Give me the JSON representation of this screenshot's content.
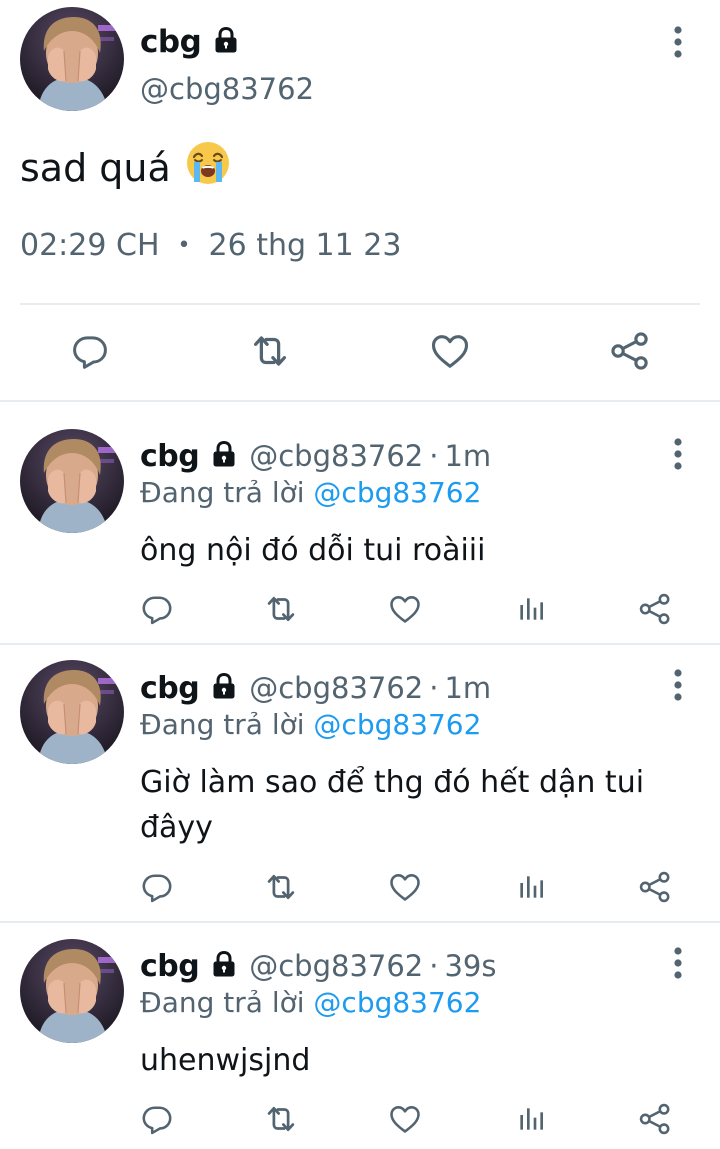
{
  "main_tweet": {
    "name": "cbg",
    "handle": "@cbg83762",
    "text": "sad quá",
    "emoji": "loudly-crying-face-emoji",
    "time": "02:29 CH",
    "separator": "•",
    "date": "26 thg 11 23"
  },
  "replies": [
    {
      "name": "cbg",
      "handle": "@cbg83762",
      "sep": "·",
      "time": "1m",
      "replying_prefix": "Đang trả lời",
      "replying_to": "@cbg83762",
      "text": "ông nội đó dỗi tui roàiii"
    },
    {
      "name": "cbg",
      "handle": "@cbg83762",
      "sep": "·",
      "time": "1m",
      "replying_prefix": "Đang trả lời",
      "replying_to": "@cbg83762",
      "text": "Giờ làm sao để thg đó hết dận tui đâyy"
    },
    {
      "name": "cbg",
      "handle": "@cbg83762",
      "sep": "·",
      "time": "39s",
      "replying_prefix": "Đang trả lời",
      "replying_to": "@cbg83762",
      "text": "uhenwjsjnd"
    }
  ],
  "icons": {
    "lock": "lock-icon",
    "more": "more-vertical-icon",
    "reply": "reply-bubble-icon",
    "retweet": "retweet-icon",
    "like": "heart-icon",
    "views": "bar-chart-icon",
    "share": "share-icon"
  },
  "colors": {
    "text_primary": "#0f1419",
    "text_secondary": "#536471",
    "link": "#1d9bf0",
    "divider": "#e6ecf0"
  }
}
